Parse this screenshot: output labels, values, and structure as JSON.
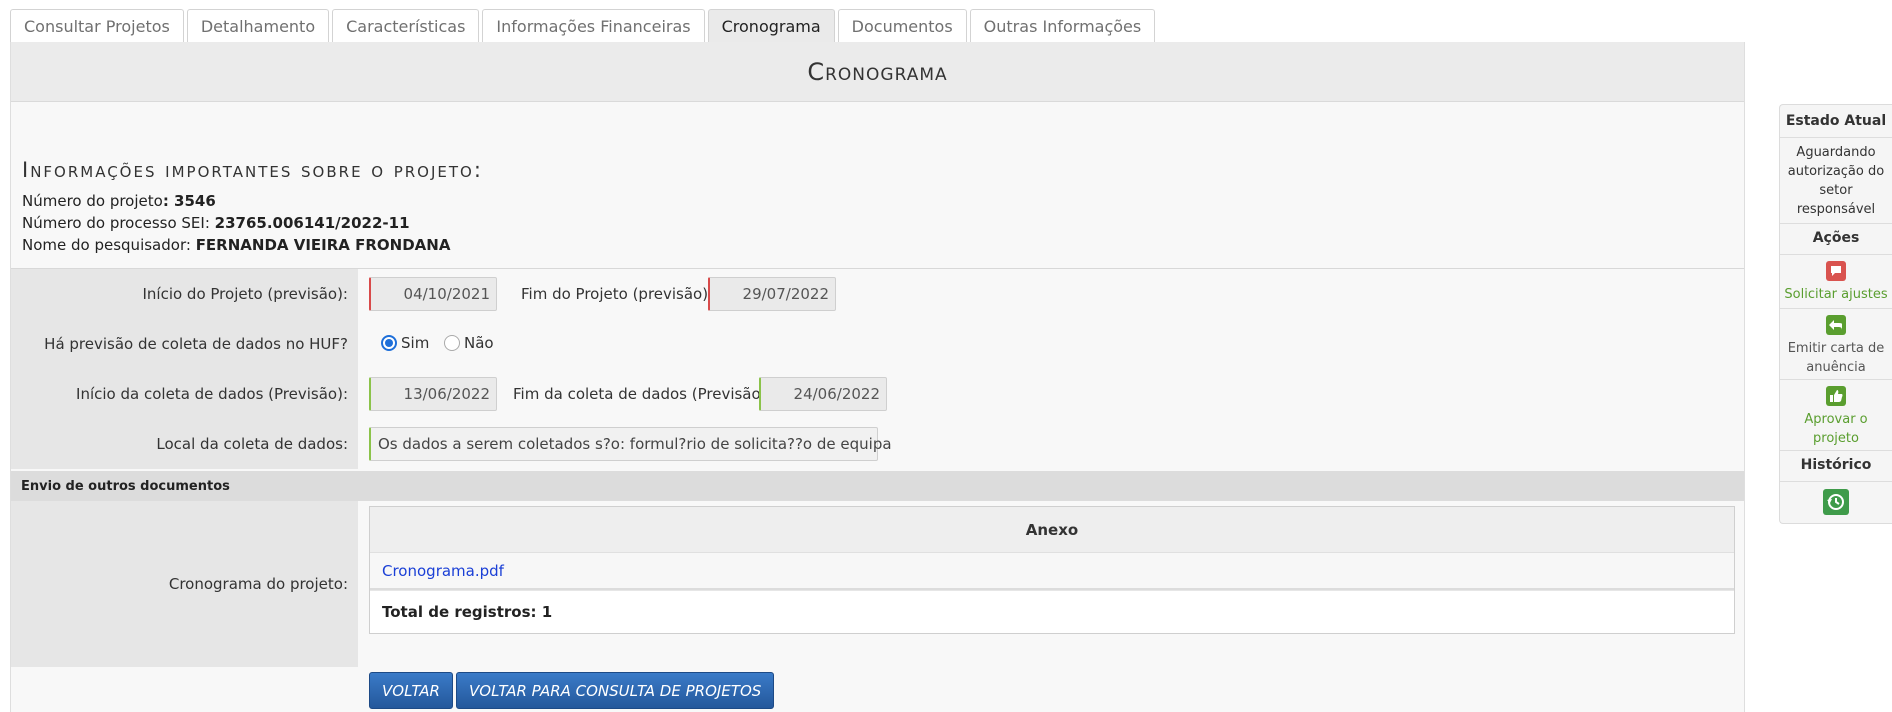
{
  "tabs": [
    {
      "label": "Consultar Projetos"
    },
    {
      "label": "Detalhamento"
    },
    {
      "label": "Características"
    },
    {
      "label": "Informações Financeiras"
    },
    {
      "label": "Cronograma",
      "active": true
    },
    {
      "label": "Documentos"
    },
    {
      "label": "Outras Informações"
    }
  ],
  "page_title": "Cronograma",
  "info": {
    "title": "Informações importantes sobre o projeto:",
    "project_number_label": "Número do projeto",
    "project_number": "3546",
    "sei_label": "Número do processo SEI:",
    "sei": "23765.006141/2022-11",
    "researcher_label": "Nome do pesquisador:",
    "researcher": "FERNANDA VIEIRA FRONDANA"
  },
  "form": {
    "start_label": "Início do Projeto (previsão):",
    "start_value": "04/10/2021",
    "end_label": "Fim do Projeto (previsão):",
    "end_value": "29/07/2022",
    "collection_question": "Há previsão de coleta de dados no HUF?",
    "radio_yes": "Sim",
    "radio_no": "Não",
    "radio_selected": "Sim",
    "collection_start_label": "Início da coleta de dados (Previsão):",
    "collection_start_value": "13/06/2022",
    "collection_end_label": "Fim da coleta de dados (Previsão):",
    "collection_end_value": "24/06/2022",
    "location_label": "Local da coleta de dados:",
    "location_value": "Os dados a serem coletados s?o: formul?rio de solicita??o de equipa"
  },
  "other_docs": {
    "section_title": "Envio de outros documentos",
    "row_label": "Cronograma do projeto:",
    "table_header": "Anexo",
    "files": [
      "Cronograma.pdf"
    ],
    "total_label": "Total de registros: 1"
  },
  "buttons": {
    "back": "VOLTAR",
    "back_to_list": "VOLTAR PARA CONSULTA DE PROJETOS"
  },
  "side": {
    "state_title": "Estado Atual",
    "state_text": "Aguardando autorização do setor responsável",
    "actions_title": "Ações",
    "request_adjust": "Solicitar ajustes",
    "emit_letter": "Emitir carta de anuência",
    "approve": "Aprovar o projeto",
    "history_title": "Histórico"
  },
  "colors": {
    "brand_blue": "#24589b",
    "request_icon": "#d9534f",
    "green_action": "#5a9e2f",
    "link_blue": "#1a3fd6"
  }
}
